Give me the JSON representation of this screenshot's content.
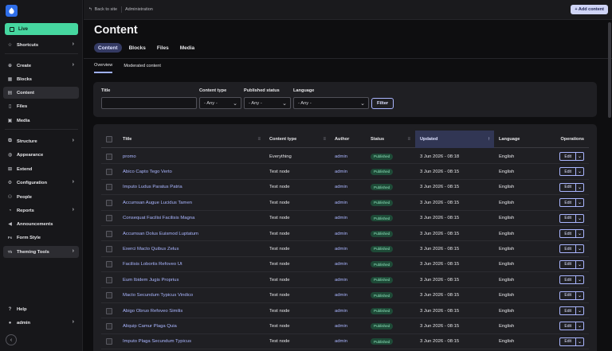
{
  "sidebar": {
    "live": "Live",
    "items": [
      {
        "label": "Shortcuts",
        "icon": "star-icon",
        "chevron": true
      },
      {
        "label": "Create",
        "icon": "plus-circle-icon",
        "chevron": true
      },
      {
        "label": "Blocks",
        "icon": "blocks-icon",
        "chevron": false
      },
      {
        "label": "Content",
        "icon": "content-icon",
        "chevron": false,
        "active": true
      },
      {
        "label": "Files",
        "icon": "file-icon",
        "chevron": false
      },
      {
        "label": "Media",
        "icon": "media-icon",
        "chevron": false
      },
      {
        "label": "Structure",
        "icon": "structure-icon",
        "chevron": true
      },
      {
        "label": "Appearance",
        "icon": "appearance-icon",
        "chevron": false
      },
      {
        "label": "Extend",
        "icon": "extend-icon",
        "chevron": false
      },
      {
        "label": "Configuration",
        "icon": "wrench-icon",
        "chevron": true
      },
      {
        "label": "People",
        "icon": "people-icon",
        "chevron": false
      },
      {
        "label": "Reports",
        "icon": "reports-icon",
        "chevron": true
      },
      {
        "label": "Announcements",
        "icon": "megaphone-icon",
        "chevron": false
      },
      {
        "label": "Form Style",
        "icon": "fs-icon",
        "chevron": false,
        "badge": "Fs"
      },
      {
        "label": "Theming Tools",
        "icon": "th-icon",
        "chevron": true,
        "badge": "Th",
        "active": true
      }
    ],
    "help": "Help",
    "user": "admin"
  },
  "topbar": {
    "back": "Back to site",
    "crumb": "Administration",
    "add": "+ Add content"
  },
  "page": {
    "title": "Content",
    "tabs": [
      "Content",
      "Blocks",
      "Files",
      "Media"
    ],
    "subtabs": [
      "Overview",
      "Moderated content"
    ]
  },
  "filter": {
    "title_label": "Title",
    "type_label": "Content type",
    "type_value": "- Any -",
    "status_label": "Published status",
    "status_value": "- Any -",
    "lang_label": "Language",
    "lang_value": "- Any -",
    "button": "Filter"
  },
  "table": {
    "headers": {
      "title": "Title",
      "type": "Content type",
      "author": "Author",
      "status": "Status",
      "updated": "Updated",
      "language": "Language",
      "operations": "Operations"
    },
    "edit_label": "Edit",
    "rows": [
      {
        "title": "promo",
        "type": "Everything",
        "author": "admin",
        "status": "Published",
        "updated": "3 Jun 2026 - 08:18",
        "language": "English"
      },
      {
        "title": "Abico Capto Tego Verto",
        "type": "Test node",
        "author": "admin",
        "status": "Published",
        "updated": "3 Jun 2026 - 08:15",
        "language": "English"
      },
      {
        "title": "Imputo Ludus Paratus Patria",
        "type": "Test node",
        "author": "admin",
        "status": "Published",
        "updated": "3 Jun 2026 - 08:15",
        "language": "English"
      },
      {
        "title": "Accumsan Augue Lucidus Tamen",
        "type": "Test node",
        "author": "admin",
        "status": "Published",
        "updated": "3 Jun 2026 - 08:15",
        "language": "English"
      },
      {
        "title": "Consequat Facilisi Facilisis Magna",
        "type": "Test node",
        "author": "admin",
        "status": "Published",
        "updated": "3 Jun 2026 - 08:15",
        "language": "English"
      },
      {
        "title": "Accumsan Dolus Euismod Luptatum",
        "type": "Test node",
        "author": "admin",
        "status": "Published",
        "updated": "3 Jun 2026 - 08:15",
        "language": "English"
      },
      {
        "title": "Exerci Macto Quibus Zelus",
        "type": "Test node",
        "author": "admin",
        "status": "Published",
        "updated": "3 Jun 2026 - 08:15",
        "language": "English"
      },
      {
        "title": "Facilisis Lobortis Refoveo Ut",
        "type": "Test node",
        "author": "admin",
        "status": "Published",
        "updated": "3 Jun 2026 - 08:15",
        "language": "English"
      },
      {
        "title": "Eum Ibidem Jugis Proprius",
        "type": "Test node",
        "author": "admin",
        "status": "Published",
        "updated": "3 Jun 2026 - 08:15",
        "language": "English"
      },
      {
        "title": "Macto Secundum Typicus Vindico",
        "type": "Test node",
        "author": "admin",
        "status": "Published",
        "updated": "3 Jun 2026 - 08:15",
        "language": "English"
      },
      {
        "title": "Abigo Obruo Refoveo Similis",
        "type": "Test node",
        "author": "admin",
        "status": "Published",
        "updated": "3 Jun 2026 - 08:15",
        "language": "English"
      },
      {
        "title": "Aliquip Camur Plaga Quia",
        "type": "Test node",
        "author": "admin",
        "status": "Published",
        "updated": "3 Jun 2026 - 08:15",
        "language": "English"
      },
      {
        "title": "Imputo Plaga Secundum Typicus",
        "type": "Test node",
        "author": "admin",
        "status": "Published",
        "updated": "3 Jun 2026 - 08:15",
        "language": "English"
      }
    ]
  }
}
